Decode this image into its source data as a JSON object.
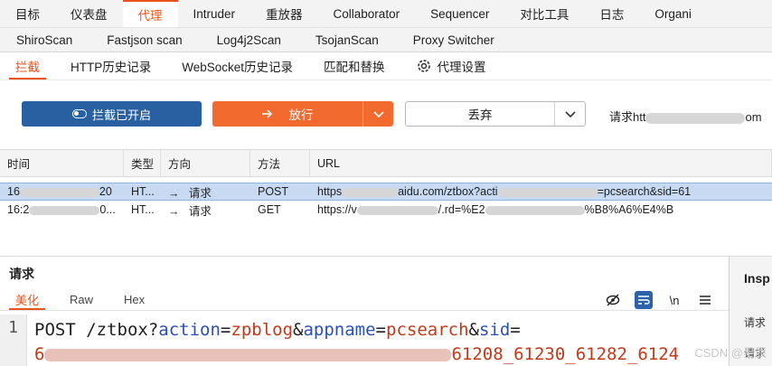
{
  "top_tabs": [
    "目标",
    "仪表盘",
    "代理",
    "Intruder",
    "重放器",
    "Collaborator",
    "Sequencer",
    "对比工具",
    "日志",
    "Organi"
  ],
  "ext_tabs": [
    "ShiroScan",
    "Fastjson scan",
    "Log4j2Scan",
    "TsojanScan",
    "Proxy Switcher"
  ],
  "proxy_tabs": [
    "拦截",
    "HTTP历史记录",
    "WebSocket历史记录",
    "匹配和替换",
    "代理设置"
  ],
  "controls": {
    "intercept_label": "拦截已开启",
    "forward_label": "放行",
    "drop_label": "丢弃",
    "request_info_prefix": "请求htt",
    "request_info_suffix": "om"
  },
  "history": {
    "columns": [
      "时间",
      "类型",
      "方向",
      "方法",
      "URL"
    ],
    "rows": [
      {
        "time": "16",
        "time_tail": "20",
        "type": "HT...",
        "dir": "请求",
        "method": "POST",
        "url_a": "https",
        "url_b": "aidu.com/ztbox?acti",
        "url_c": "=pcsearch&sid=61"
      },
      {
        "time": "16:2",
        "time_tail": "0...",
        "type": "HT...",
        "dir": "请求",
        "method": "GET",
        "url_a": "https://v",
        "url_b": "/.rd=%E2",
        "url_c": "%B8%A6%E4%B"
      }
    ]
  },
  "request_pane": {
    "title": "请求",
    "view_tabs": [
      "美化",
      "Raw",
      "Hex"
    ],
    "newline_icon_label": "\\n",
    "line_number": "1",
    "code": {
      "method": "POST ",
      "path": "/ztbox?",
      "p1_key": "action",
      "p1_val": "zpblog",
      "p2_key": "appname",
      "p2_val": "pcsearch",
      "p3_key": "sid",
      "line2_start": "6",
      "line2_end": "61208_61230_61282_6124"
    }
  },
  "inspector": {
    "title": "Insp",
    "row1": "请求",
    "row2": "请求"
  },
  "watermark": "CSDN @星辰"
}
